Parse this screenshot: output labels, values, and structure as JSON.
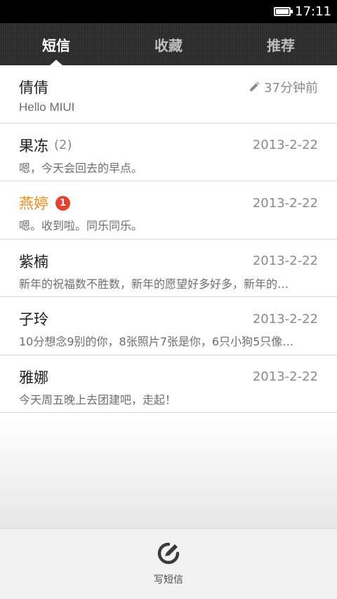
{
  "status": {
    "time": "17:11"
  },
  "tabs": [
    {
      "label": "短信",
      "active": true
    },
    {
      "label": "收藏",
      "active": false
    },
    {
      "label": "推荐",
      "active": false
    }
  ],
  "conversations": [
    {
      "name": "倩倩",
      "count": "",
      "badge": "",
      "time": "37分钟前",
      "snippet": "Hello MIUI",
      "unread": false,
      "draft": true
    },
    {
      "name": "果冻",
      "count": "(2)",
      "badge": "",
      "time": "2013-2-22",
      "snippet": "嗯，今天会回去的早点。",
      "unread": false,
      "draft": false
    },
    {
      "name": "燕婷",
      "count": "",
      "badge": "1",
      "time": "2013-2-22",
      "snippet": "嗯。收到啦。同乐同乐。",
      "unread": true,
      "draft": false
    },
    {
      "name": "紫楠",
      "count": "",
      "badge": "",
      "time": "2013-2-22",
      "snippet": "新年的祝福数不胜数，新年的愿望好多好多，新年的…",
      "unread": false,
      "draft": false
    },
    {
      "name": "子玲",
      "count": "",
      "badge": "",
      "time": "2013-2-22",
      "snippet": "10分想念9别的你，8张照片7张是你，6只小狗5只像…",
      "unread": false,
      "draft": false
    },
    {
      "name": "雅娜",
      "count": "",
      "badge": "",
      "time": "2013-2-22",
      "snippet": "今天周五晚上去团建吧，走起！",
      "unread": false,
      "draft": false
    }
  ],
  "compose": {
    "label": "写短信"
  },
  "colors": {
    "accent_unread": "#f08b20",
    "badge": "#e8412f"
  }
}
